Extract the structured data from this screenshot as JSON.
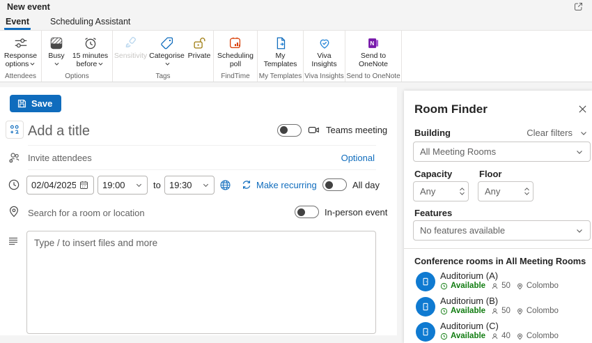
{
  "window": {
    "title": "New event"
  },
  "tabs": [
    {
      "label": "Event",
      "selected": true
    },
    {
      "label": "Scheduling Assistant",
      "selected": false
    }
  ],
  "ribbon": {
    "groups": [
      {
        "label": "Attendees",
        "buttons": [
          {
            "label": "Response options",
            "lines": [
              "Response",
              "options"
            ],
            "icon": "sliders-icon",
            "dropdown": true
          }
        ]
      },
      {
        "label": "Options",
        "buttons": [
          {
            "label": "Busy",
            "lines": [
              "Busy",
              ""
            ],
            "icon": "busy-status-icon",
            "dropdown": true
          },
          {
            "label": "15 minutes before",
            "lines": [
              "15 minutes",
              "before"
            ],
            "icon": "alarm-icon",
            "dropdown": true
          }
        ]
      },
      {
        "label": "Tags",
        "buttons": [
          {
            "label": "Sensitivity",
            "lines": [
              "Sensitivity",
              ""
            ],
            "icon": "brush-icon",
            "disabled": true
          },
          {
            "label": "Categorise",
            "lines": [
              "Categorise",
              ""
            ],
            "icon": "tag-icon",
            "dropdown": true
          },
          {
            "label": "Private",
            "lines": [
              "Private",
              ""
            ],
            "icon": "padlock-open-icon"
          }
        ]
      },
      {
        "label": "FindTime",
        "buttons": [
          {
            "label": "Scheduling poll",
            "lines": [
              "Scheduling",
              "poll"
            ],
            "icon": "poll-calendar-icon"
          }
        ]
      },
      {
        "label": "My Templates",
        "buttons": [
          {
            "label": "My Templates",
            "lines": [
              "My",
              "Templates"
            ],
            "icon": "template-doc-icon"
          }
        ]
      },
      {
        "label": "Viva Insights",
        "buttons": [
          {
            "label": "Viva Insights",
            "lines": [
              "Viva",
              "Insights"
            ],
            "icon": "viva-insights-icon"
          }
        ]
      },
      {
        "label": "Send to OneNote",
        "buttons": [
          {
            "label": "Send to OneNote",
            "lines": [
              "Send to",
              "OneNote"
            ],
            "icon": "onenote-icon"
          }
        ]
      }
    ]
  },
  "form": {
    "save_label": "Save",
    "title_placeholder": "Add a title",
    "teams_toggle_label": "Teams meeting",
    "attendees_placeholder": "Invite attendees",
    "optional_label": "Optional",
    "date_value": "02/04/2025",
    "start_time": "19:00",
    "to_label": "to",
    "end_time": "19:30",
    "recurring_label": "Make recurring",
    "all_day_label": "All day",
    "location_placeholder": "Search for a room or location",
    "in_person_label": "In-person event",
    "body_placeholder": "Type / to insert files and more"
  },
  "room_finder": {
    "title": "Room Finder",
    "building_label": "Building",
    "clear_filters_label": "Clear filters",
    "building_value": "All Meeting Rooms",
    "capacity_label": "Capacity",
    "capacity_value": "Any",
    "floor_label": "Floor",
    "floor_value": "Any",
    "features_label": "Features",
    "features_value": "No features available",
    "rooms_heading": "Conference rooms in All Meeting Rooms",
    "rooms": [
      {
        "name": "Auditorium (A)",
        "status": "Available",
        "capacity": "50",
        "location": "Colombo"
      },
      {
        "name": "Auditorium (B)",
        "status": "Available",
        "capacity": "50",
        "location": "Colombo"
      },
      {
        "name": "Auditorium (C)",
        "status": "Available",
        "capacity": "40",
        "location": "Colombo"
      }
    ]
  },
  "icons": {
    "open-in-new-window-icon": "window with arrow",
    "sliders-icon": "two sliders",
    "busy-status-icon": "hatched square",
    "alarm-icon": "alarm clock",
    "brush-icon": "paintbrush (disabled)",
    "tag-icon": "category tag",
    "padlock-open-icon": "open lock",
    "poll-calendar-icon": "calendar with bars",
    "template-doc-icon": "document",
    "viva-insights-icon": "heart with check",
    "onenote-icon": "OneNote logo",
    "save-icon": "floppy disk",
    "charm-picker-icon": "blue charm dots",
    "person-add-icon": "people with plus",
    "clock-icon": "clock",
    "location-pin-icon": "map pin",
    "text-lines-icon": "text lines",
    "video-camera-icon": "camera",
    "globe-icon": "globe",
    "recurring-icon": "circular arrows",
    "chevron-down-icon": "chevron down",
    "close-icon": "x",
    "door-icon": "room door",
    "person-icon": "person",
    "calendar-icon": "calendar"
  },
  "colors": {
    "accent": "#0f6cbd",
    "available_green": "#107c10",
    "avatar_blue": "#0f7ad1",
    "private_gold": "#9d7a0c",
    "poll_orange": "#d83b01",
    "onenote_purple": "#7719aa"
  }
}
